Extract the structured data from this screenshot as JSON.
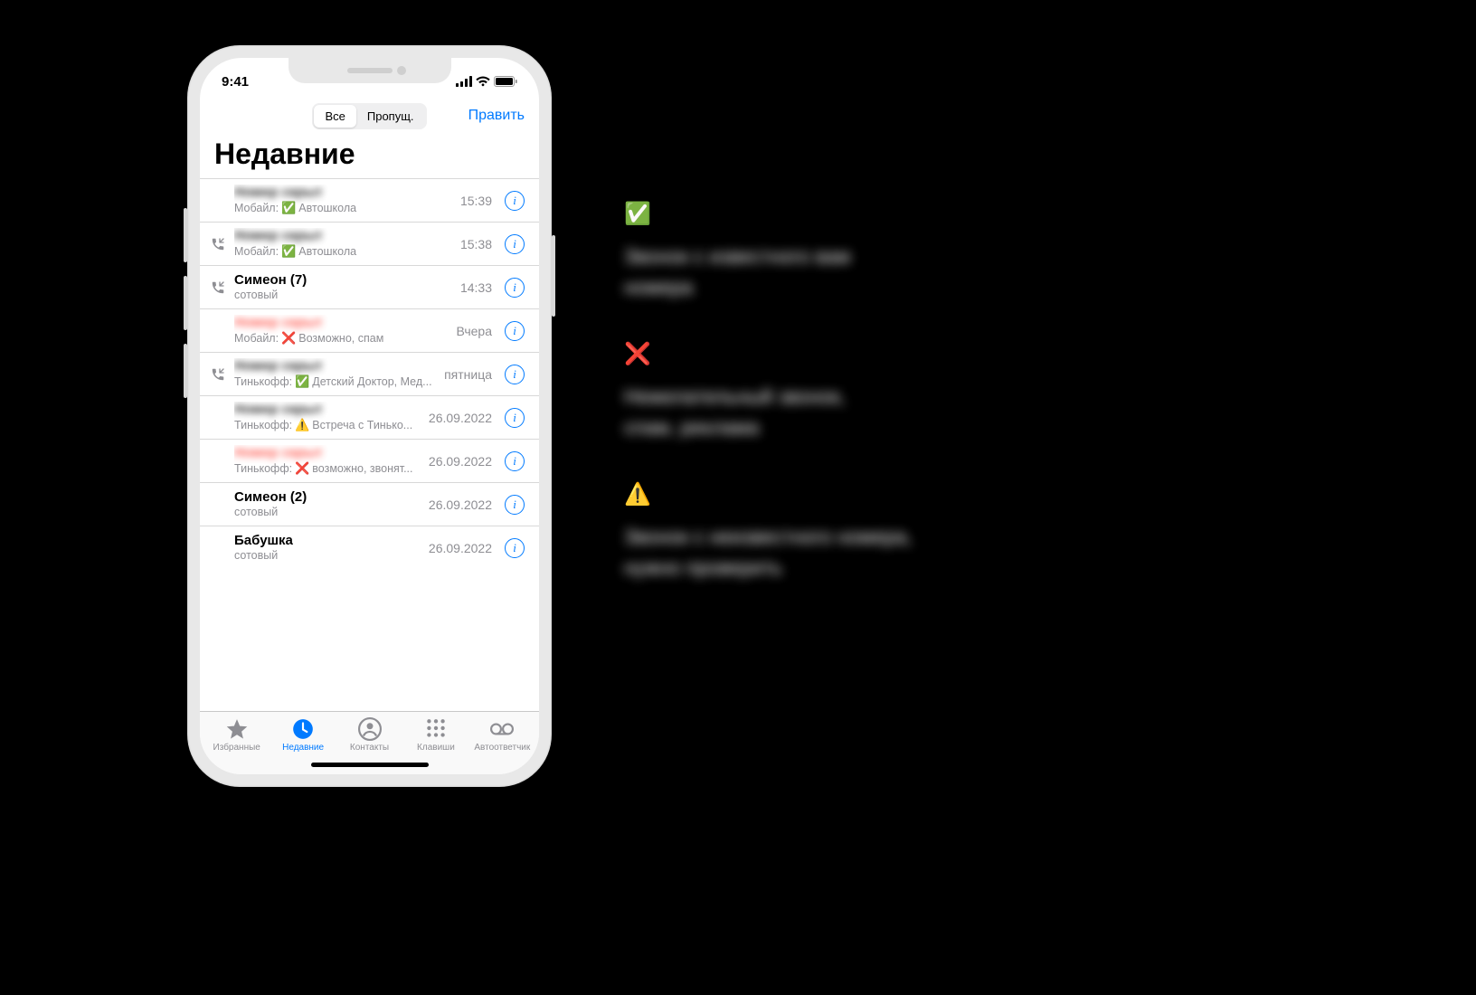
{
  "statusbar": {
    "time": "9:41"
  },
  "navbar": {
    "segment": {
      "all": "Все",
      "missed": "Пропущ."
    },
    "edit": "Править"
  },
  "title": "Недавние",
  "legend": [
    {
      "emoji": "✅",
      "text_l1": "Звонок с известного вам",
      "text_l2": "номера"
    },
    {
      "emoji": "❌",
      "text_l1": "Нежелательный звонок,",
      "text_l2": "спам, реклама"
    },
    {
      "emoji": "⚠️",
      "text_l1": "Звонок с неизвестного номера,",
      "text_l2": "нужно проверить"
    }
  ],
  "tabs": {
    "favorites": "Избранные",
    "recents": "Недавние",
    "contacts": "Контакты",
    "keypad": "Клавиши",
    "voicemail": "Автоответчик"
  },
  "calls": [
    {
      "name": "Номер скрыт",
      "blurred": true,
      "incoming_icon": false,
      "missed": false,
      "sub_prefix": "Мобайл:",
      "sub_emoji": "✅",
      "sub_text": "Автошкола",
      "time": "15:39"
    },
    {
      "name": "Номер скрыт",
      "blurred": true,
      "incoming_icon": true,
      "missed": false,
      "sub_prefix": "Мобайл:",
      "sub_emoji": "✅",
      "sub_text": "Автошкола",
      "time": "15:38"
    },
    {
      "name": "Симеон (7)",
      "blurred": false,
      "incoming_icon": true,
      "missed": false,
      "sub_prefix": "сотовый",
      "sub_emoji": "",
      "sub_text": "",
      "time": "14:33"
    },
    {
      "name": "Номер скрыт",
      "blurred": true,
      "incoming_icon": false,
      "missed": true,
      "sub_prefix": "Мобайл:",
      "sub_emoji": "❌",
      "sub_text": "Возможно, спам",
      "time": "Вчера"
    },
    {
      "name": "Номер скрыт",
      "blurred": true,
      "incoming_icon": true,
      "missed": false,
      "sub_prefix": "Тинькофф:",
      "sub_emoji": "✅",
      "sub_text": "Детский Доктор, Мед...",
      "time": "пятница"
    },
    {
      "name": "Номер скрыт",
      "blurred": true,
      "incoming_icon": false,
      "missed": false,
      "sub_prefix": "Тинькофф:",
      "sub_emoji": "⚠️",
      "sub_text": "Встреча с Тинько...",
      "time": "26.09.2022"
    },
    {
      "name": "Номер скрыт",
      "blurred": true,
      "incoming_icon": false,
      "missed": true,
      "sub_prefix": "Тинькофф:",
      "sub_emoji": "❌",
      "sub_text": "возможно, звонят...",
      "time": "26.09.2022"
    },
    {
      "name": "Симеон (2)",
      "blurred": false,
      "incoming_icon": false,
      "missed": false,
      "sub_prefix": "сотовый",
      "sub_emoji": "",
      "sub_text": "",
      "time": "26.09.2022"
    },
    {
      "name": "Бабушка",
      "blurred": false,
      "incoming_icon": false,
      "missed": false,
      "sub_prefix": "сотовый",
      "sub_emoji": "",
      "sub_text": "",
      "time": "26.09.2022"
    }
  ]
}
